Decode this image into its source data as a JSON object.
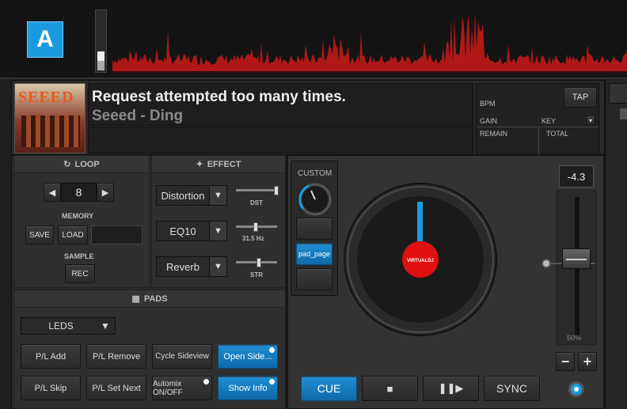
{
  "deck": {
    "letter": "A",
    "track_title": "Request attempted too many times.",
    "track_artist": "Seeed - Ding",
    "album_art_text": "SEEED",
    "info": {
      "bpm_label": "BPM",
      "tap_label": "TAP",
      "gain_label": "GAIN",
      "key_label": "KEY",
      "remain_label": "REMAIN",
      "total_label": "TOTAL"
    }
  },
  "loop": {
    "header": "LOOP",
    "value": "8",
    "memory_label": "MEMORY",
    "save_label": "SAVE",
    "load_label": "LOAD",
    "sample_label": "SAMPLE",
    "rec_label": "REC"
  },
  "effect": {
    "header": "EFFECT",
    "slots": [
      {
        "name": "Distortion",
        "param": "DST"
      },
      {
        "name": "EQ10",
        "param": "31.5 Hz"
      },
      {
        "name": "Reverb",
        "param": "STR"
      }
    ]
  },
  "pads": {
    "header": "PADS",
    "mode": "LEDS",
    "buttons": [
      "P/L Add",
      "P/L Remove",
      "Cycle Sideview",
      "Open Side...",
      "P/L Skip",
      "P/L Set Next",
      "Automix ON/OFF",
      "Show Info"
    ]
  },
  "custom": {
    "label": "CUSTOM",
    "pad_page": "pad_page"
  },
  "turntable": {
    "logo": "VIRTUALDJ"
  },
  "pitch": {
    "value": "-4.3",
    "range": "50%"
  },
  "transport": {
    "cue": "CUE",
    "sync": "SYNC"
  },
  "colors": {
    "accent": "#1a9be0",
    "waveform": "#b01818",
    "platter_center": "#e01010"
  }
}
